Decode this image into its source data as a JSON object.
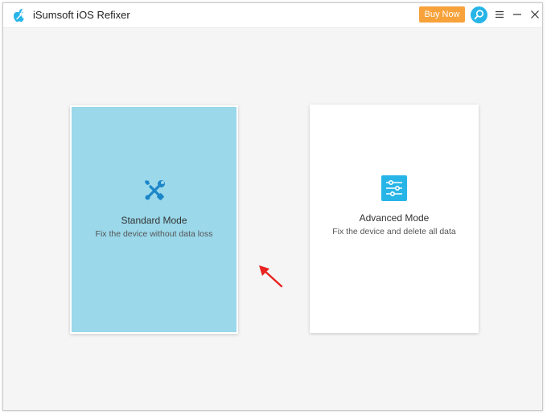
{
  "titlebar": {
    "app_title": "iSumsoft iOS Refixer",
    "buy_now_label": "Buy Now",
    "icons": [
      "app-logo",
      "search-icon",
      "menu-icon",
      "minimize-icon",
      "close-icon"
    ]
  },
  "modes": [
    {
      "title": "Standard Mode",
      "description": "Fix the device without data loss",
      "icon": "tools-icon",
      "selected": true
    },
    {
      "title": "Advanced Mode",
      "description": "Fix the device and delete all data",
      "icon": "sliders-icon",
      "selected": false
    }
  ],
  "colors": {
    "accent": "#27b5e8",
    "buy_button": "#f7a23a",
    "selected_card": "#9ad8ea",
    "annotation_arrow": "#e8231f"
  }
}
